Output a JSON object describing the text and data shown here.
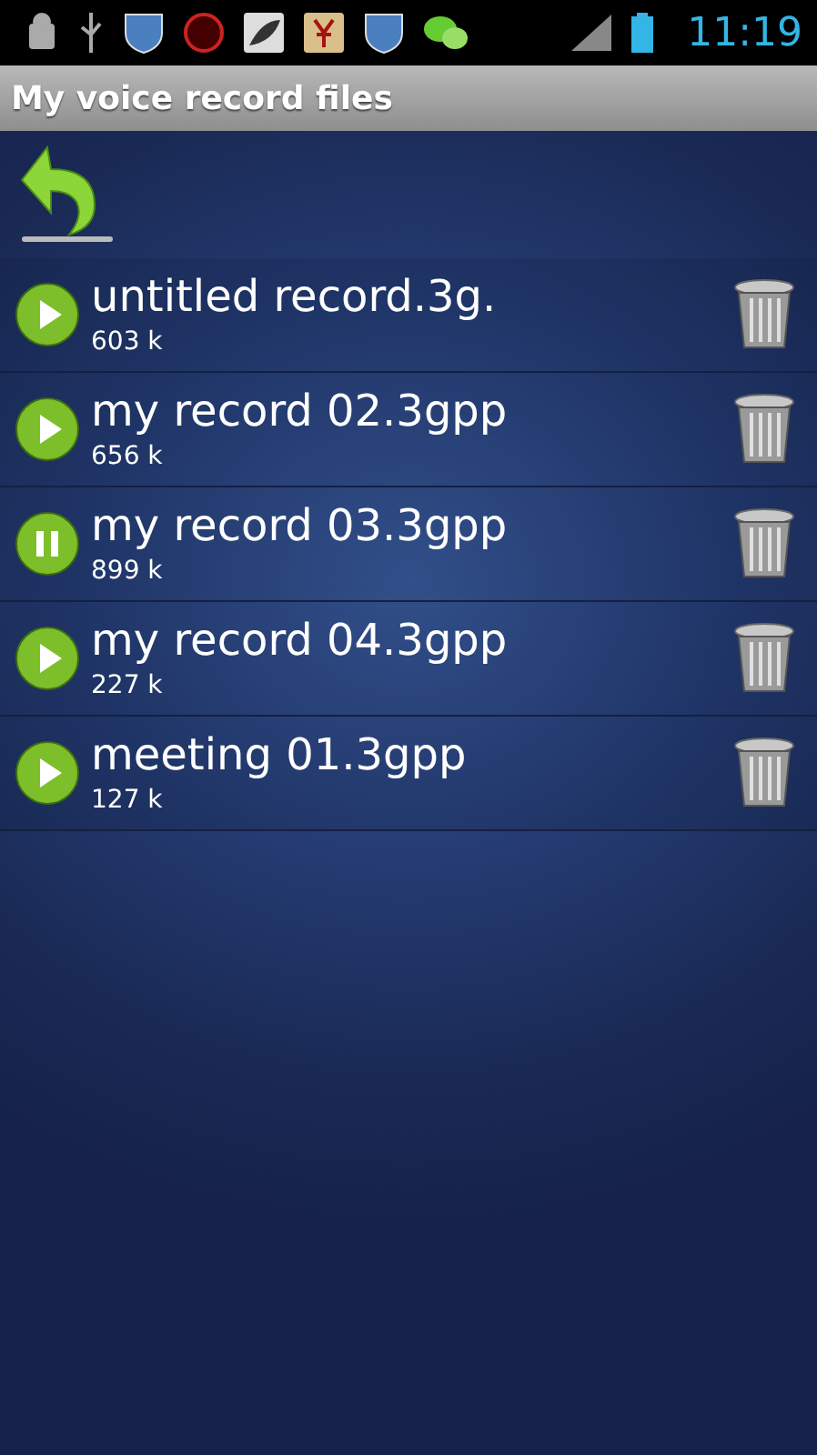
{
  "status_bar": {
    "time": "11:19"
  },
  "title": "My voice record files",
  "records": [
    {
      "name": "untitled record.3g.",
      "size": "603 k",
      "playing": false
    },
    {
      "name": "my record 02.3gpp",
      "size": "656 k",
      "playing": false
    },
    {
      "name": "my record 03.3gpp",
      "size": "899 k",
      "playing": true
    },
    {
      "name": "my record 04.3gpp",
      "size": "227 k",
      "playing": false
    },
    {
      "name": "meeting 01.3gpp",
      "size": "127 k",
      "playing": false
    }
  ]
}
